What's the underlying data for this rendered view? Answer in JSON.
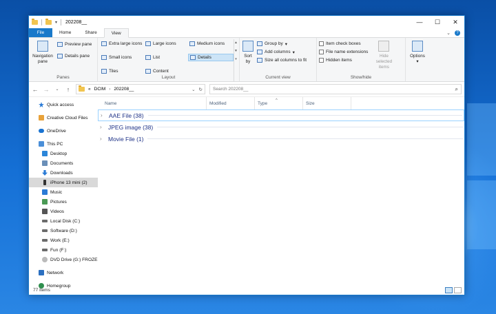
{
  "window": {
    "title": "202208__",
    "controls": {
      "minimize": "—",
      "maximize": "☐",
      "close": "✕"
    }
  },
  "tabs": [
    {
      "label": "File"
    },
    {
      "label": "Home"
    },
    {
      "label": "Share"
    },
    {
      "label": "View"
    }
  ],
  "ribbon": {
    "panes": {
      "navigation_pane": "Navigation pane",
      "preview_pane": "Preview pane",
      "details_pane": "Details pane",
      "group_label": "Panes"
    },
    "layout": {
      "options": [
        "Extra large icons",
        "Large icons",
        "Medium icons",
        "Small icons",
        "List",
        "Details",
        "Tiles",
        "Content"
      ],
      "selected": "Details",
      "group_label": "Layout"
    },
    "current_view": {
      "sort_by": "Sort by",
      "group_by": "Group by",
      "add_columns": "Add columns",
      "size_all_columns": "Size all columns to fit",
      "group_label": "Current view"
    },
    "show_hide": {
      "item_check_boxes": "Item check boxes",
      "file_name_extensions": "File name extensions",
      "hidden_items": "Hidden items",
      "hide_selected": "Hide selected items",
      "group_label": "Show/hide"
    },
    "options": "Options"
  },
  "address": {
    "path": [
      "DCIM",
      "202208__"
    ],
    "overflow": "«",
    "search_placeholder": "Search 202208__"
  },
  "nav_pane": {
    "items": [
      {
        "label": "Quick access",
        "icon": "star-icon",
        "color": "#2b7bd6"
      },
      {
        "label": "Creative Cloud Files",
        "icon": "cloud-folder-icon",
        "color": "#e8a23a"
      },
      {
        "label": "OneDrive",
        "icon": "cloud-icon",
        "color": "#1a73d1"
      },
      {
        "label": "This PC",
        "icon": "computer-icon",
        "color": "#4a8fd8"
      },
      {
        "label": "Desktop",
        "icon": "desktop-icon",
        "color": "#2b86d9"
      },
      {
        "label": "Documents",
        "icon": "documents-icon",
        "color": "#6a8fb8"
      },
      {
        "label": "Downloads",
        "icon": "download-icon",
        "color": "#2b7bd6"
      },
      {
        "label": "iPhone 13 mini (2)",
        "icon": "phone-icon",
        "color": "#333333"
      },
      {
        "label": "Music",
        "icon": "music-icon",
        "color": "#2b7bd6"
      },
      {
        "label": "Pictures",
        "icon": "pictures-icon",
        "color": "#4a9a55"
      },
      {
        "label": "Videos",
        "icon": "videos-icon",
        "color": "#555555"
      },
      {
        "label": "Local Disk (C:)",
        "icon": "disk-icon",
        "color": "#6b6b6b"
      },
      {
        "label": "Software (D:)",
        "icon": "disk-icon",
        "color": "#6b6b6b"
      },
      {
        "label": "Work (E:)",
        "icon": "disk-icon",
        "color": "#6b6b6b"
      },
      {
        "label": "Fun (F:)",
        "icon": "disk-icon",
        "color": "#6b6b6b"
      },
      {
        "label": "DVD Drive (G:) FROZE",
        "icon": "dvd-icon",
        "color": "#9a9a9a"
      },
      {
        "label": "Network",
        "icon": "network-icon",
        "color": "#2b6fc0"
      },
      {
        "label": "Homegroup",
        "icon": "homegroup-icon",
        "color": "#2f8f4e"
      }
    ],
    "selected": "iPhone 13 mini (2)"
  },
  "columns": [
    "Name",
    "Modified",
    "Type",
    "Size"
  ],
  "groups": [
    {
      "label": "AAE File (38)"
    },
    {
      "label": "JPEG image (38)"
    },
    {
      "label": "Movie File (1)"
    }
  ],
  "status": {
    "item_count": "77 items"
  },
  "colors": {
    "accent": "#1979ca",
    "group_text": "#1e3287",
    "selection": "#cce4f7"
  }
}
